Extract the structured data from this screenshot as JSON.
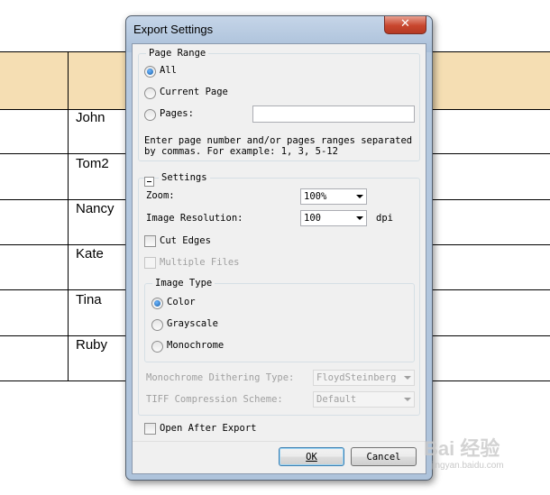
{
  "sheet": {
    "names": [
      "John",
      "Tom2",
      "Nancy",
      "Kate",
      "Tina",
      "Ruby"
    ]
  },
  "dialog": {
    "title": "Export Settings",
    "close_glyph": "✕",
    "page_range": {
      "legend": "Page Range",
      "all_label": "All",
      "current_label": "Current Page",
      "pages_label": "Pages:",
      "pages_value": "",
      "selected": "All",
      "hint_line1": "Enter page number and/or pages ranges separated",
      "hint_line2": "by commas. For example: 1, 3, 5-12"
    },
    "settings": {
      "legend": "Settings",
      "zoom_label": "Zoom:",
      "zoom_value": "100%",
      "resolution_label": "Image Resolution:",
      "resolution_value": "100",
      "resolution_unit": "dpi",
      "cut_edges_label": "Cut Edges",
      "cut_edges_checked": false,
      "multiple_files_label": "Multiple Files",
      "multiple_files_checked": false,
      "image_type": {
        "legend": "Image Type",
        "color_label": "Color",
        "grayscale_label": "Grayscale",
        "monochrome_label": "Monochrome",
        "selected": "Color"
      },
      "dithering_label": "Monochrome Dithering Type:",
      "dithering_value": "FloydSteinberg",
      "tiff_label": "TIFF Compression Scheme:",
      "tiff_value": "Default"
    },
    "open_after_label": "Open After Export",
    "open_after_checked": false,
    "ok_label": "OK",
    "cancel_label": "Cancel"
  },
  "watermark": {
    "logo": "Bai 经验",
    "url": "jingyan.baidu.com"
  }
}
